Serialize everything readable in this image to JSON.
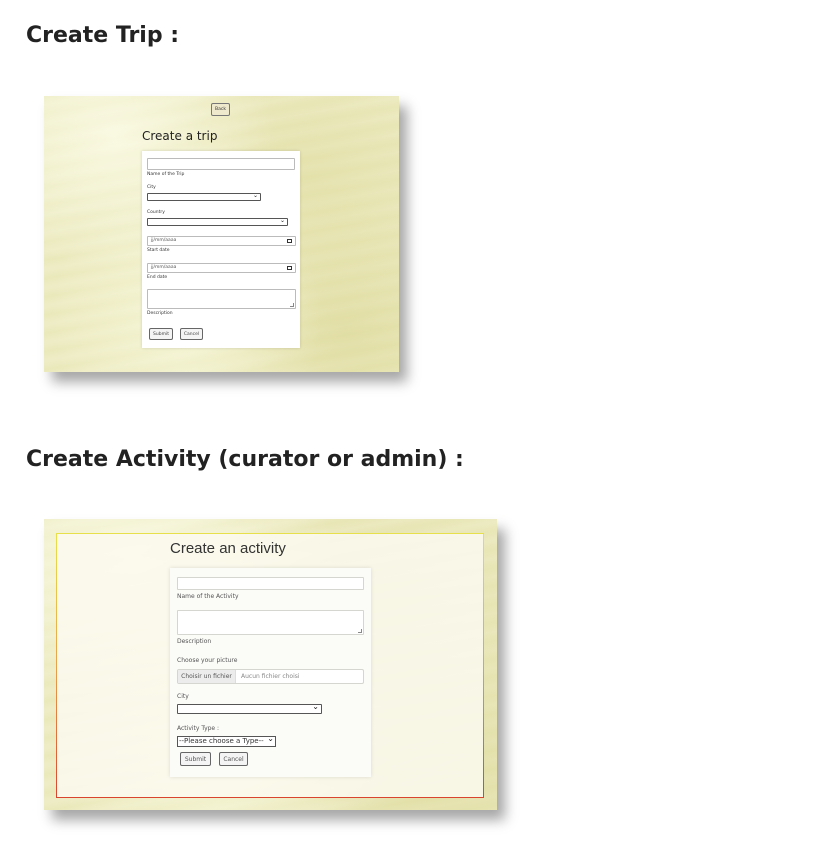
{
  "sections": {
    "trip_title": "Create Trip :",
    "activity_title": "Create Activity (curator or admin) :"
  },
  "trip_form": {
    "back_label": "Back",
    "heading": "Create a trip",
    "name_label": "Name of the Trip",
    "city_label": "City",
    "country_label": "Country",
    "start_placeholder": "jj/mm/aaaa",
    "start_label": "Start date",
    "end_placeholder": "jj/mm/aaaa",
    "end_label": "End date",
    "description_label": "Description",
    "submit_label": "Submit",
    "cancel_label": "Cancel"
  },
  "activity_form": {
    "heading": "Create an activity",
    "name_label": "Name of the Activity",
    "description_label": "Description",
    "picture_label": "Choose your picture",
    "file_button": "Choisir un fichier",
    "file_status": "Aucun fichier choisi",
    "city_label": "City",
    "type_label": "Activity Type :",
    "type_selected": "--Please choose a Type--",
    "submit_label": "Submit",
    "cancel_label": "Cancel"
  },
  "colors": {
    "parchment": "#ecebc4",
    "frame_top": "#e8e04a",
    "frame_bottom": "#d9442f"
  },
  "icons": {
    "select_arrow": "chevron-down-icon",
    "date_picker": "calendar-icon"
  }
}
